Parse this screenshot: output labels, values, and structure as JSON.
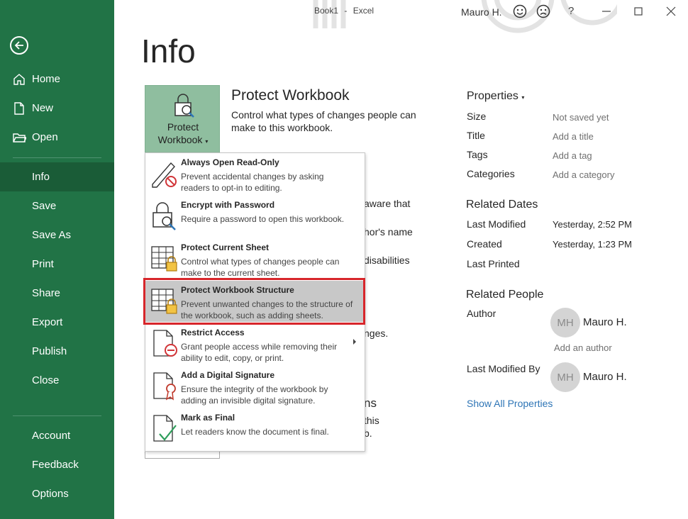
{
  "titlebar": {
    "doc_name": "Book1",
    "separator": "-",
    "app_name": "Excel",
    "user": "Mauro H.",
    "help": "?"
  },
  "sidebar": {
    "items": [
      {
        "label": "Home",
        "icon": "home-icon"
      },
      {
        "label": "New",
        "icon": "new-document-icon"
      },
      {
        "label": "Open",
        "icon": "open-folder-icon"
      },
      {
        "label": "Info",
        "selected": true
      },
      {
        "label": "Save"
      },
      {
        "label": "Save As"
      },
      {
        "label": "Print"
      },
      {
        "label": "Share"
      },
      {
        "label": "Export"
      },
      {
        "label": "Publish"
      },
      {
        "label": "Close"
      },
      {
        "label": "Account"
      },
      {
        "label": "Feedback"
      },
      {
        "label": "Options"
      }
    ]
  },
  "main": {
    "title": "Info",
    "protect_tile": {
      "line1": "Protect",
      "line2": "Workbook",
      "caret": "▾"
    },
    "protect_heading": "Protect Workbook",
    "protect_desc": "Control what types of changes people can make to this workbook.",
    "peek_texts": [
      "aware that",
      "hor's name",
      "disabilities",
      "nges.",
      "ns",
      "this",
      "b."
    ]
  },
  "dropdown": {
    "items": [
      {
        "title": "Always Open Read-Only",
        "desc": "Prevent accidental changes by asking readers to opt-in to editing.",
        "icon": "pencil-no-icon"
      },
      {
        "title": "Encrypt with Password",
        "desc": "Require a password to open this workbook.",
        "icon": "lock-key-icon"
      },
      {
        "title": "Protect Current Sheet",
        "desc": "Control what types of changes people can make to the current sheet.",
        "icon": "sheet-lock-icon"
      },
      {
        "title": "Protect Workbook Structure",
        "desc": "Prevent unwanted changes to the structure of the workbook, such as adding sheets.",
        "icon": "workbook-lock-icon",
        "highlighted": true
      },
      {
        "title": "Restrict Access",
        "desc": "Grant people access while removing their ability to edit, copy, or print.",
        "icon": "restrict-access-icon",
        "has_submenu": true
      },
      {
        "title": "Add a Digital Signature",
        "desc": "Ensure the integrity of the workbook by adding an invisible digital signature.",
        "icon": "signature-ribbon-icon"
      },
      {
        "title": "Mark as Final",
        "desc": "Let readers know the document is final.",
        "icon": "check-document-icon"
      }
    ]
  },
  "properties": {
    "heading": "Properties",
    "caret": "▾",
    "rows": [
      {
        "label": "Size",
        "value": "Not saved yet"
      },
      {
        "label": "Title",
        "value": "Add a title"
      },
      {
        "label": "Tags",
        "value": "Add a tag"
      },
      {
        "label": "Categories",
        "value": "Add a category"
      }
    ],
    "related_dates": {
      "heading": "Related Dates",
      "rows": [
        {
          "label": "Last Modified",
          "value": "Yesterday, 2:52 PM"
        },
        {
          "label": "Created",
          "value": "Yesterday, 1:23 PM"
        },
        {
          "label": "Last Printed",
          "value": ""
        }
      ]
    },
    "related_people": {
      "heading": "Related People",
      "author_label": "Author",
      "author_initials": "MH",
      "author_name": "Mauro H.",
      "add_author": "Add an author",
      "modified_by_label": "Last Modified By",
      "modified_initials": "MH",
      "modified_name": "Mauro H."
    },
    "show_all": "Show All Properties"
  },
  "colors": {
    "sidebar": "#217346",
    "sidebar_selected": "#1a5c37",
    "tile": "#8fbe9f",
    "highlight_border": "#d7262b",
    "link": "#2e75b6"
  }
}
